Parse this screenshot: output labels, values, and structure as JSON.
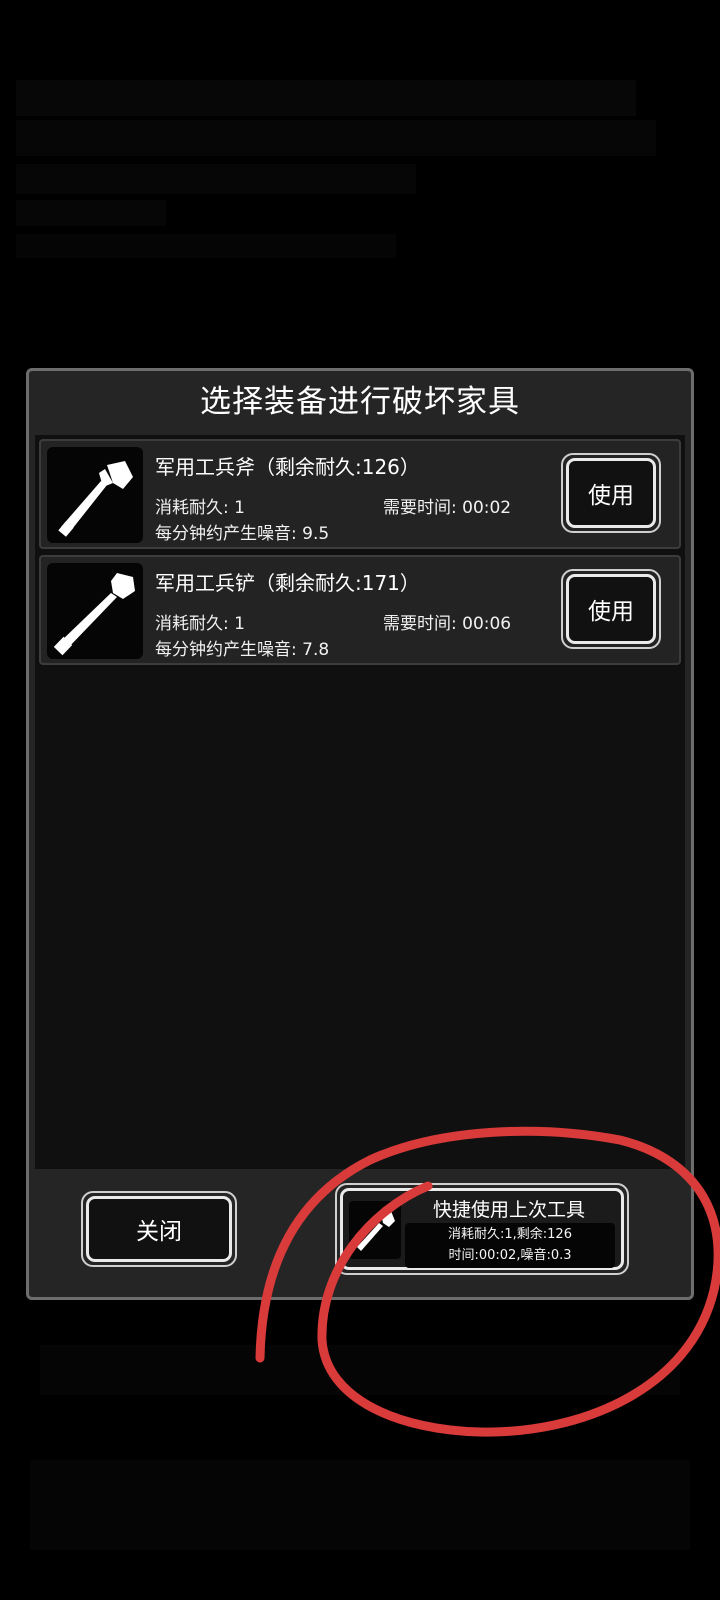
{
  "dialog": {
    "title": "选择装备进行破坏家具"
  },
  "tools": [
    {
      "name": "军用工兵斧（剩余耐久:126）",
      "cost": "消耗耐久: 1",
      "time": "需要时间: 00:02",
      "noise": "每分钟约产生噪音: 9.5",
      "use_label": "使用",
      "icon": "axe-icon"
    },
    {
      "name": "军用工兵铲（剩余耐久:171）",
      "cost": "消耗耐久: 1",
      "time": "需要时间: 00:06",
      "noise": "每分钟约产生噪音: 7.8",
      "use_label": "使用",
      "icon": "shovel-icon"
    }
  ],
  "footer": {
    "close_label": "关闭",
    "quick": {
      "title": "快捷使用上次工具",
      "line1": "消耗耐久:1,剩余:126",
      "line2": "时间:00:02,噪音:0.3",
      "icon": "axe-icon"
    }
  },
  "colors": {
    "panel": "#252525",
    "list_bg": "#101010",
    "annotation": "#d93a3a"
  }
}
